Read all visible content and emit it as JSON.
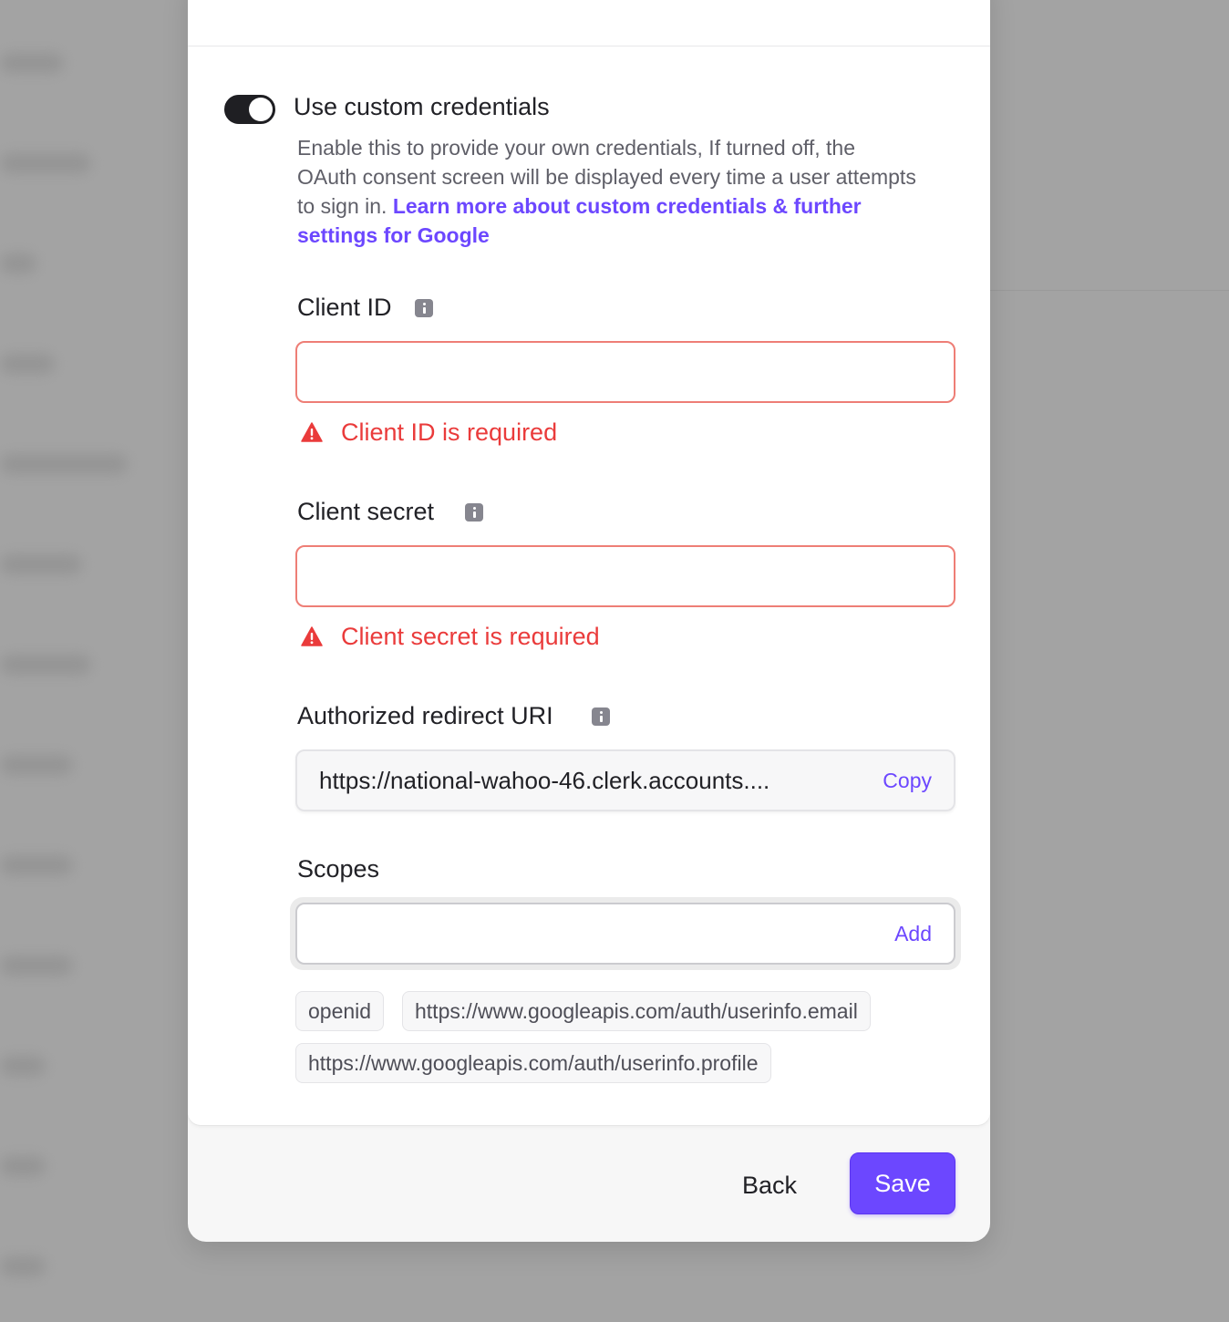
{
  "toggle": {
    "title": "Use custom credentials",
    "description": "Enable this to provide your own credentials, If turned off, the OAuth consent screen will be displayed every time a user attempts to sign in.",
    "link_text": "Learn more about custom credentials & further settings for Google",
    "enabled": true
  },
  "client_id": {
    "label": "Client ID",
    "value": "",
    "error": "Client ID is required"
  },
  "client_secret": {
    "label": "Client secret",
    "value": "",
    "error": "Client secret is required"
  },
  "redirect_uri": {
    "label": "Authorized redirect URI",
    "value": "https://national-wahoo-46.clerk.accounts....",
    "copy_label": "Copy"
  },
  "scopes": {
    "label": "Scopes",
    "input_value": "",
    "add_label": "Add",
    "items": [
      "openid",
      "https://www.googleapis.com/auth/userinfo.email",
      "https://www.googleapis.com/auth/userinfo.profile"
    ]
  },
  "footer": {
    "back_label": "Back",
    "save_label": "Save"
  },
  "colors": {
    "accent": "#6c47ff",
    "error": "#ea3b3b",
    "error_border": "#ee7e76"
  }
}
